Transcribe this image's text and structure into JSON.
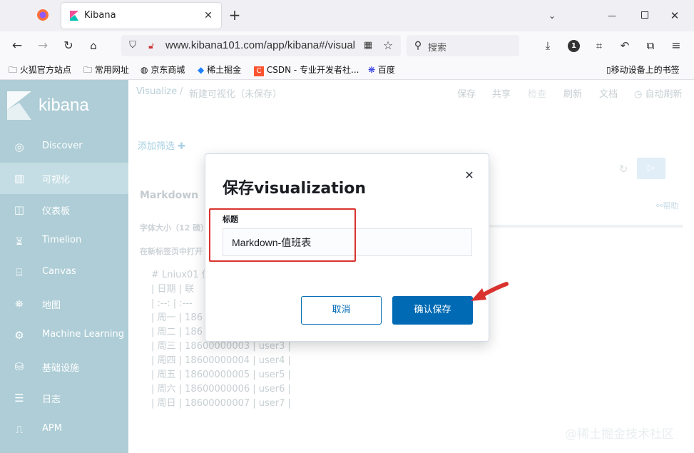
{
  "browser": {
    "tab_title": "Kibana",
    "new_tab_symbol": "+",
    "url": "www.kibana101.com/app/kibana#/visual",
    "search_placeholder": "搜索",
    "badge_count": "1",
    "bookmarks": [
      "火狐官方站点",
      "常用网址",
      "京东商城",
      "稀土掘金",
      "CSDN - 专业开发者社...",
      "百度"
    ],
    "mobile_bookmarks": "移动设备上的书签"
  },
  "sidebar": {
    "logo_text": "kibana",
    "items": [
      {
        "label": "Discover",
        "icon": "compass-icon"
      },
      {
        "label": "可视化",
        "icon": "visualize-icon"
      },
      {
        "label": "仪表板",
        "icon": "dashboard-icon"
      },
      {
        "label": "Timelion",
        "icon": "timelion-icon"
      },
      {
        "label": "Canvas",
        "icon": "canvas-icon"
      },
      {
        "label": "地图",
        "icon": "map-icon"
      },
      {
        "label": "Machine Learning",
        "icon": "ml-icon"
      },
      {
        "label": "基础设施",
        "icon": "infra-icon"
      },
      {
        "label": "日志",
        "icon": "logs-icon"
      },
      {
        "label": "APM",
        "icon": "apm-icon"
      }
    ]
  },
  "topnav": {
    "breadcrumb_root": "Visualize",
    "breadcrumb_sep": "/",
    "breadcrumb_current": "新建可视化（未保存）",
    "actions": [
      "保存",
      "共享",
      "检查",
      "刷新",
      "文档"
    ],
    "auto_refresh": "自动刷新"
  },
  "editor": {
    "add_filter": "添加筛选",
    "panel_title": "Markdown",
    "help": "帮助",
    "font_size_label": "字体大小（12 磅）",
    "open_links_label": "在新标签页中打开",
    "markdown_lines": [
      "# Lniux01 值",
      "| 日期 | 联",
      "| :--: | :---",
      "| 周一 | 186",
      "| 周二 | 186",
      "| 周三 | 18600000003 | user3 |",
      "| 周四 | 18600000004 | user4 |",
      "| 周五 | 18600000005 | user5 |",
      "| 周六 | 18600000006 | user6 |",
      "| 周日 | 18600000007 | user7 |"
    ]
  },
  "modal": {
    "title": "保存visualization",
    "field_label": "标题",
    "input_value": "Markdown-值班表",
    "cancel": "取消",
    "confirm": "确认保存"
  },
  "watermark": "@稀土掘金技术社区",
  "colors": {
    "accent": "#006bb4",
    "sidebar": "#aecdd6",
    "annotation_red": "#d9322e"
  }
}
